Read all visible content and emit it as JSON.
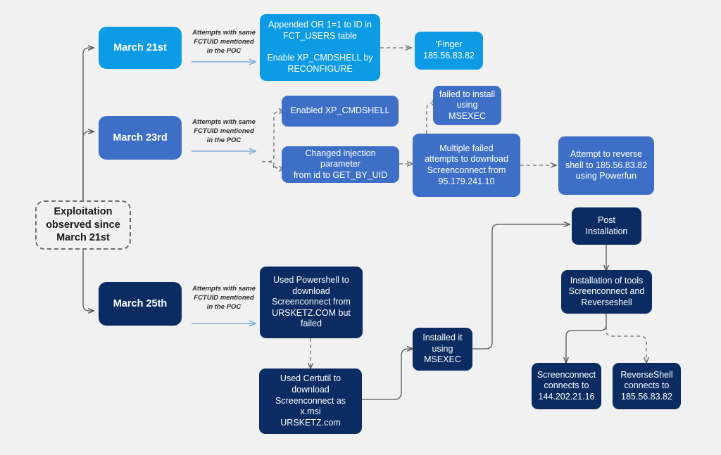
{
  "diagram": {
    "title": "Exploitation timeline flowchart",
    "background_color": "#f1f1f1",
    "colors": {
      "cyan": "#0d9be6",
      "royal_blue": "#3d6fc7",
      "navy": "#0a2c62",
      "connector": "#555555",
      "label_arrow": "#7fb0e0",
      "dashed_border": "#6d6d6d"
    },
    "start_node": {
      "label": "Exploitation\nobserved since\nMarch 21st",
      "style": "dashed-outline"
    },
    "branches": [
      {
        "date": "March 21st",
        "color": "cyan",
        "edge_label": "Attempts with same\nFCTUID mentioned\nin the POC"
      },
      {
        "date": "March 23rd",
        "color": "royal",
        "edge_label": "Attempts with same\nFCTUID mentioned\nin the POC"
      },
      {
        "date": "March 25th",
        "color": "navy",
        "edge_label": "Attempts with same\nFCTUID mentioned\nin the POC"
      }
    ],
    "nodes": {
      "appended_or": "Appended OR 1=1 to ID in\nFCT_USERS table\n\nEnable XP_CMDSHELL by\nRECONFIGURE",
      "finger_ip": "'Finger\n185.56.83.82",
      "enabled_cmdshell": "Enabled XP_CMDSHELL",
      "changed_injection": "Changed injection parameter\nfrom id to GET_BY_UID",
      "failed_install": "failed to install\nusing MSEXEC",
      "multiple_failed": "Multiple failed\nattempts to download\nScreenconnect from\n95.179.241.10",
      "reverse_shell_attempt": "Attempt to reverse\nshell to 185.56.83.82\nusing Powerfun",
      "used_powershell": "Used Powershell to\ndownload\nScreenconnect from\nURSKETZ.COM but failed",
      "used_certutil": "Used Certutil to\ndownload\nScreenconnect as x.msi\nURSKETZ.com",
      "installed_msexec": "Installed it\nusing\nMSEXEC",
      "post_installation": "Post\nInstallation",
      "installation_of_tools": "Installation of tools\nScreenconnect and\nReverseshell",
      "screenconnect_connects": "Screenconnect\nconnects to\n144.202.21.16",
      "reverseshell_connects": "ReverseShell\nconnects to\n185.56.83.82"
    }
  }
}
